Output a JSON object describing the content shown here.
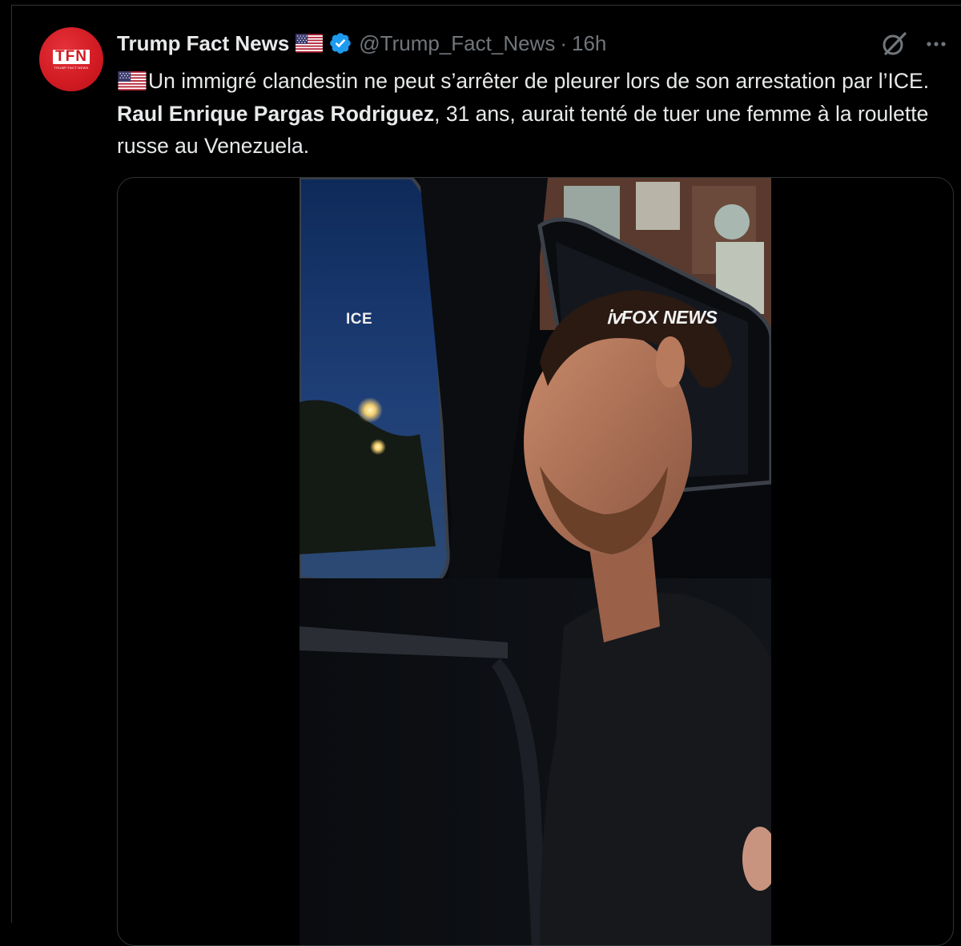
{
  "tweet": {
    "display_name": "Trump Fact News",
    "handle": "@Trump_Fact_News",
    "separator": "·",
    "time": "16h",
    "avatar_text": "TFN",
    "avatar_subtext": "TRUMP FACT NEWS",
    "text_part1": "Un immigré clandestin ne peut s’arrêter de pleurer lors de son arrestation par l’ICE. ",
    "text_bold": "Raul Enrique Pargas Rodriguez",
    "text_part2": ", 31 ans, aurait tenté de tuer une femme à la roulette russe au Venezuela."
  },
  "media": {
    "overlay_left": "ICE",
    "overlay_right": "FOX NEWS"
  },
  "icons": {
    "flag": "us-flag-icon",
    "verified": "verified-badge-icon",
    "grok": "grok-icon",
    "more": "more-options-icon"
  },
  "colors": {
    "background": "#000000",
    "text": "#e7e9ea",
    "secondary_text": "#71767b",
    "verified_blue": "#1d9bf0",
    "avatar_red": "#d11a22",
    "border": "#2f3336"
  }
}
